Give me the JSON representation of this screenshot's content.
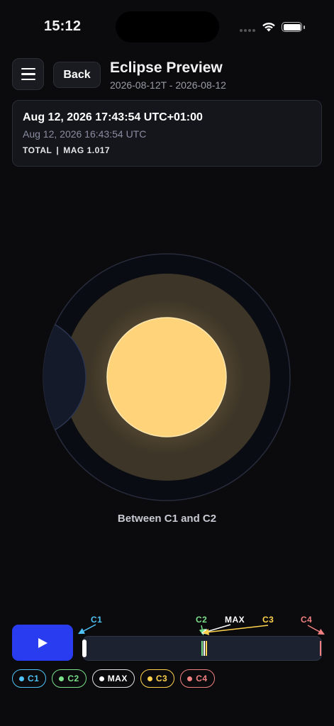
{
  "status_bar": {
    "time": "15:12"
  },
  "header": {
    "menu_icon": "hamburger-menu-icon",
    "back_label": "Back",
    "title": "Eclipse Preview",
    "date_range": "2026-08-12T - 2026-08-12"
  },
  "info_card": {
    "local_time": "Aug 12, 2026 17:43:54 UTC+01:00",
    "utc_time": "Aug 12, 2026 16:43:54 UTC",
    "type": "TOTAL",
    "separator": "|",
    "magnitude": "MAG 1.017"
  },
  "eclipse_view": {
    "phase_label": "Between C1 and C2"
  },
  "timeline": {
    "play_icon": "play-icon",
    "markers": {
      "c1": "C1",
      "c2": "C2",
      "max": "MAX",
      "c3": "C3",
      "c4": "C4"
    },
    "progress": 0.0
  },
  "legend": [
    {
      "label": "C1",
      "color": "#4fc3f7"
    },
    {
      "label": "C2",
      "color": "#7be08a"
    },
    {
      "label": "MAX",
      "color": "#ffffff"
    },
    {
      "label": "C3",
      "color": "#ffd24d"
    },
    {
      "label": "C4",
      "color": "#f08080"
    }
  ],
  "colors": {
    "accent": "#2a3cf0",
    "sun": "#ffd37a",
    "corona": "#4a4030",
    "moon": "#141a2a",
    "c1": "#4fc3f7",
    "c2": "#7be08a",
    "max": "#ffffff",
    "c3": "#ffd24d",
    "c4": "#f08080"
  }
}
